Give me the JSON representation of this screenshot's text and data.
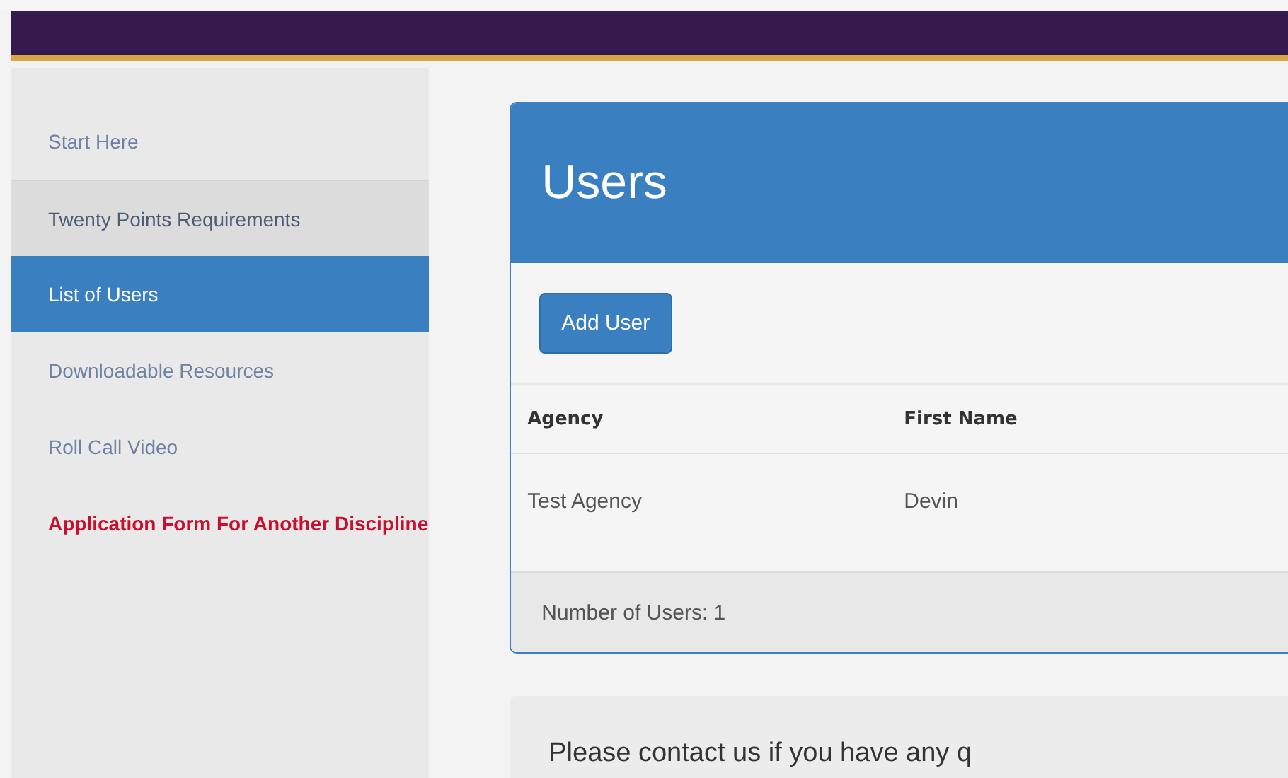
{
  "sidebar": {
    "items": [
      {
        "label": "Start Here",
        "selected": false,
        "highlighted": false,
        "kind": "link"
      },
      {
        "label": "Twenty Points Requirements",
        "selected": false,
        "highlighted": true,
        "kind": "link"
      },
      {
        "label": "List of Users",
        "selected": true,
        "highlighted": false,
        "kind": "link"
      },
      {
        "label": "Downloadable Resources",
        "selected": false,
        "highlighted": false,
        "kind": "link"
      },
      {
        "label": "Roll Call Video",
        "selected": false,
        "highlighted": false,
        "kind": "link"
      },
      {
        "label": "Application Form For Another Discipline",
        "selected": false,
        "highlighted": false,
        "kind": "emphasis"
      }
    ]
  },
  "panel": {
    "title": "Users",
    "add_button": "Add User",
    "table": {
      "columns": [
        "Agency",
        "First Name"
      ],
      "rows": [
        [
          "Test Agency",
          "Devin"
        ]
      ]
    },
    "footer": "Number of Users: 1"
  },
  "contact": {
    "text": "Please contact us if you have any q"
  }
}
